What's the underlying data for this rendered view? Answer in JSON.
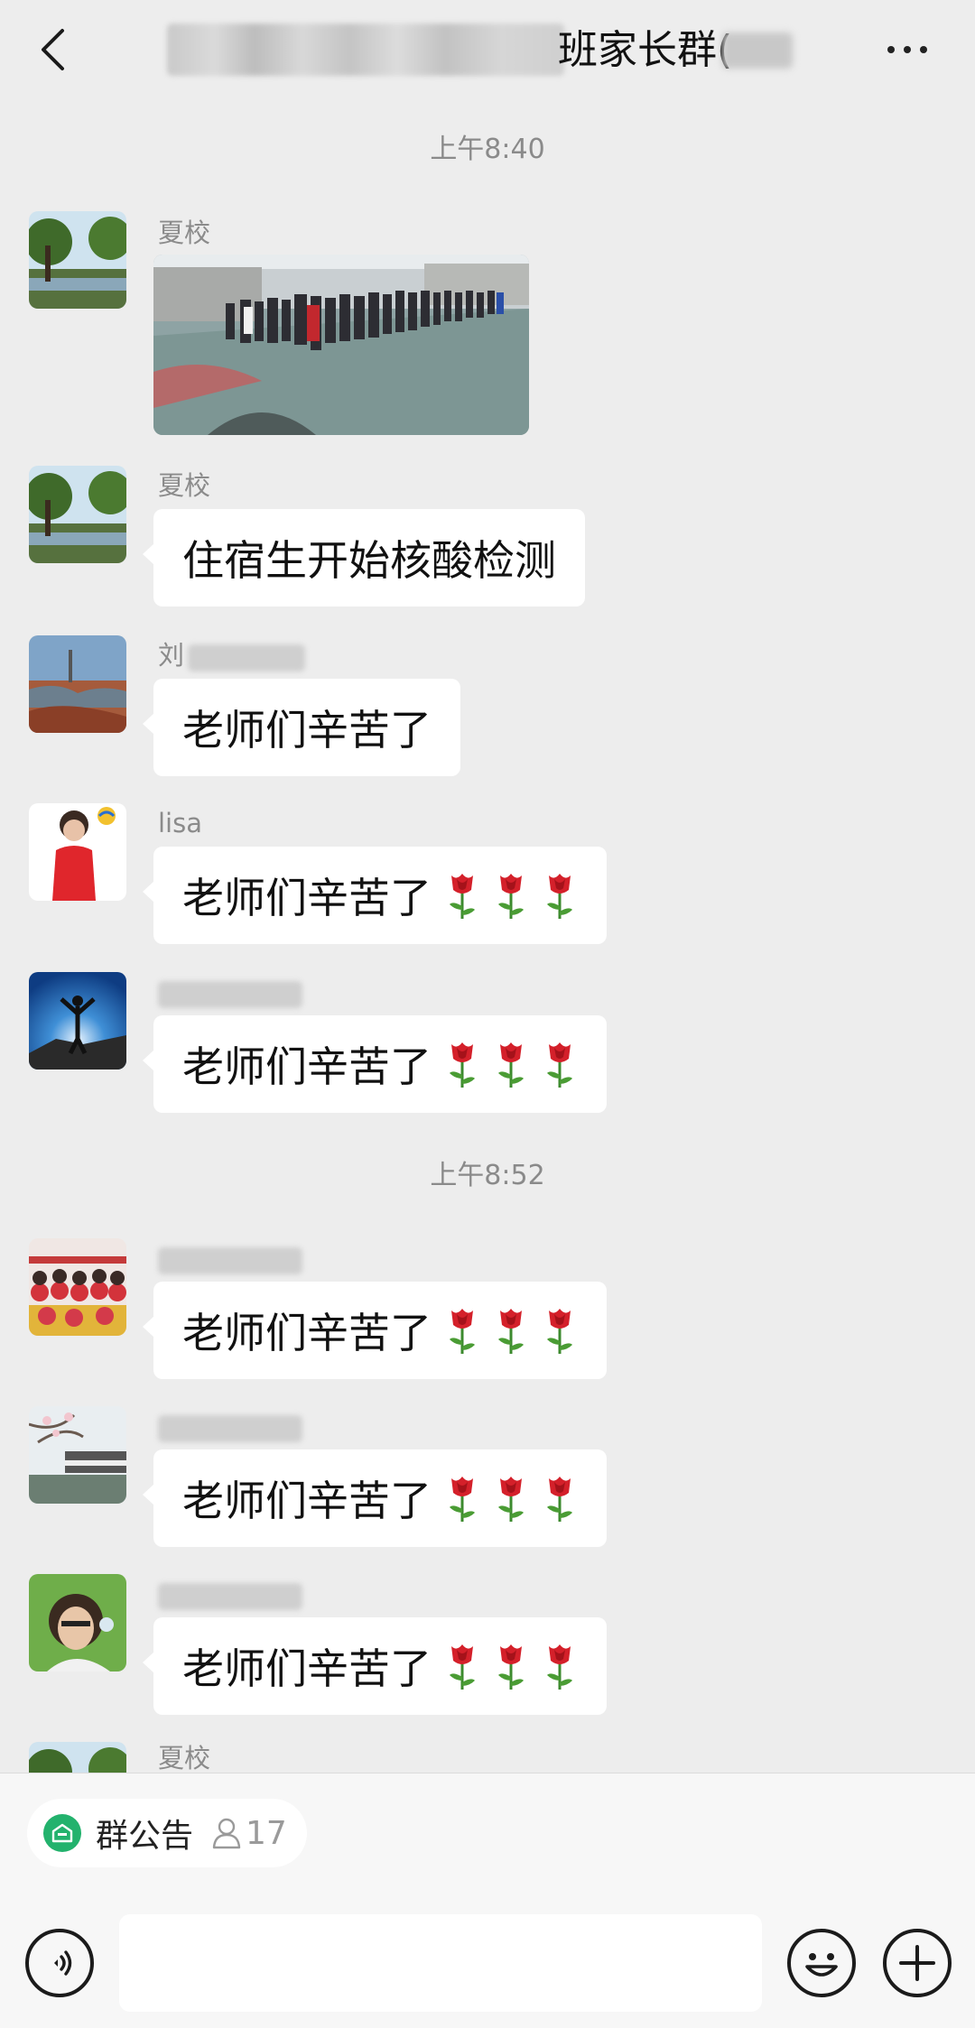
{
  "header": {
    "title_visible": "班家长群(",
    "back_icon": "chevron-left-icon",
    "more_icon": "more-dots-icon"
  },
  "timestamps": [
    "上午8:40",
    "上午8:52"
  ],
  "messages": [
    {
      "sender": "夏校",
      "type": "image"
    },
    {
      "sender": "夏校",
      "text": "住宿生开始核酸检测"
    },
    {
      "sender": "刘",
      "text": "老师们辛苦了"
    },
    {
      "sender": "lisa",
      "text": "老师们辛苦了",
      "emoji": [
        "rose",
        "rose",
        "rose"
      ]
    },
    {
      "sender": "",
      "text": "老师们辛苦了",
      "emoji": [
        "rose",
        "rose",
        "rose"
      ]
    },
    {
      "sender": "",
      "text": "老师们辛苦了",
      "emoji": [
        "rose",
        "rose",
        "rose"
      ]
    },
    {
      "sender": "",
      "text": "老师们辛苦了",
      "emoji": [
        "rose",
        "rose",
        "rose"
      ]
    },
    {
      "sender": "",
      "text": "老师们辛苦了",
      "emoji": [
        "rose",
        "rose",
        "rose"
      ]
    },
    {
      "sender": "夏校"
    }
  ],
  "bottom": {
    "notice_label": "群公告",
    "member_count": "17",
    "input_placeholder": ""
  },
  "colors": {
    "background": "#ededed",
    "bubble": "#ffffff",
    "notice_icon": "#23b26d",
    "timestamp": "#8a8a8a"
  }
}
